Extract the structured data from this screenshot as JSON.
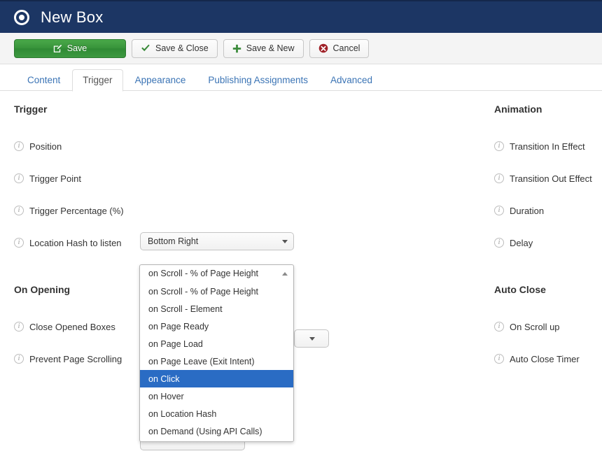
{
  "header": {
    "title": "New Box",
    "icon": "target-dot-icon"
  },
  "toolbar": {
    "buttons": [
      {
        "label": "Save",
        "icon": "edit-pencil-icon",
        "style": "primary"
      },
      {
        "label": "Save & Close",
        "icon": "check-icon",
        "style": "default"
      },
      {
        "label": "Save & New",
        "icon": "plus-icon",
        "style": "default"
      },
      {
        "label": "Cancel",
        "icon": "cancel-circle-icon",
        "style": "default"
      }
    ]
  },
  "tabs": [
    {
      "label": "Content",
      "active": false
    },
    {
      "label": "Trigger",
      "active": true
    },
    {
      "label": "Appearance",
      "active": false
    },
    {
      "label": "Publishing Assignments",
      "active": false
    },
    {
      "label": "Advanced",
      "active": false
    }
  ],
  "left": {
    "trigger_section_title": "Trigger",
    "fields": [
      {
        "label": "Position"
      },
      {
        "label": "Trigger Point"
      },
      {
        "label": "Trigger Percentage (%)"
      },
      {
        "label": "Location Hash to listen"
      }
    ],
    "on_opening_section_title": "On Opening",
    "on_opening_fields": [
      {
        "label": "Close Opened Boxes"
      },
      {
        "label": "Prevent Page Scrolling"
      }
    ]
  },
  "right": {
    "animation_section_title": "Animation",
    "animation_fields": [
      {
        "label": "Transition In Effect"
      },
      {
        "label": "Transition Out Effect"
      },
      {
        "label": "Duration"
      },
      {
        "label": "Delay"
      }
    ],
    "auto_close_section_title": "Auto Close",
    "auto_close_fields": [
      {
        "label": "On Scroll up"
      },
      {
        "label": "Auto Close Timer"
      }
    ]
  },
  "selects": {
    "position": {
      "value": "Bottom Right"
    },
    "trigger_point": {
      "value": "on Scroll - % of Page Height"
    },
    "location_hash": {
      "value": ""
    },
    "under_list": {
      "value": ""
    }
  },
  "dropdown": {
    "header_text": "on Scroll - % of Page Height",
    "options": [
      "on Scroll - % of Page Height",
      "on Scroll - Element",
      "on Page Ready",
      "on Page Load",
      "on Page Leave (Exit Intent)",
      "on Click",
      "on Hover",
      "on Location Hash",
      "on Demand (Using API Calls)"
    ],
    "selected": "on Click"
  },
  "colors": {
    "header_bg": "#1c3664",
    "toolbar_bg": "#f4f4f4",
    "primary_button": "#37933a",
    "cancel_icon": "#a02128",
    "tab_link": "#3b74b5",
    "dropdown_highlight": "#2a6cc4"
  }
}
